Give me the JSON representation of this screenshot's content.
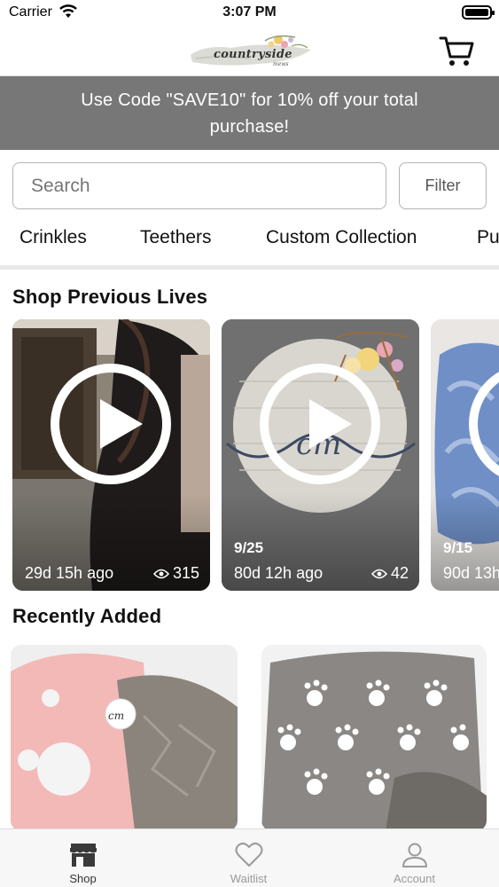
{
  "status_bar": {
    "carrier": "Carrier",
    "time": "3:07 PM",
    "battery_level": 0.9
  },
  "header": {
    "logo_text": "countryside",
    "logo_sub": "mews"
  },
  "promo": {
    "text": "Use Code \"SAVE10\" for 10% off your total purchase!"
  },
  "search": {
    "placeholder": "Search",
    "filter_label": "Filter"
  },
  "categories": [
    "Crinkles",
    "Teethers",
    "Custom Collection",
    "Pu"
  ],
  "shop_previous_lives": {
    "title": "Shop Previous Lives",
    "items": [
      {
        "date": "",
        "ago": "29d 15h ago",
        "views": "315"
      },
      {
        "date": "9/25",
        "ago": "80d 12h ago",
        "views": "42"
      },
      {
        "date": "9/15",
        "ago": "90d 13h",
        "views": ""
      }
    ]
  },
  "recently_added": {
    "title": "Recently Added"
  },
  "tabs": [
    {
      "label": "Shop",
      "icon": "shop-icon",
      "active": true
    },
    {
      "label": "Waitlist",
      "icon": "heart-icon",
      "active": false
    },
    {
      "label": "Account",
      "icon": "person-icon",
      "active": false
    }
  ],
  "colors": {
    "promo_bg": "#777777",
    "tab_active": "#333333",
    "tab_inactive": "#9a9a9a"
  }
}
